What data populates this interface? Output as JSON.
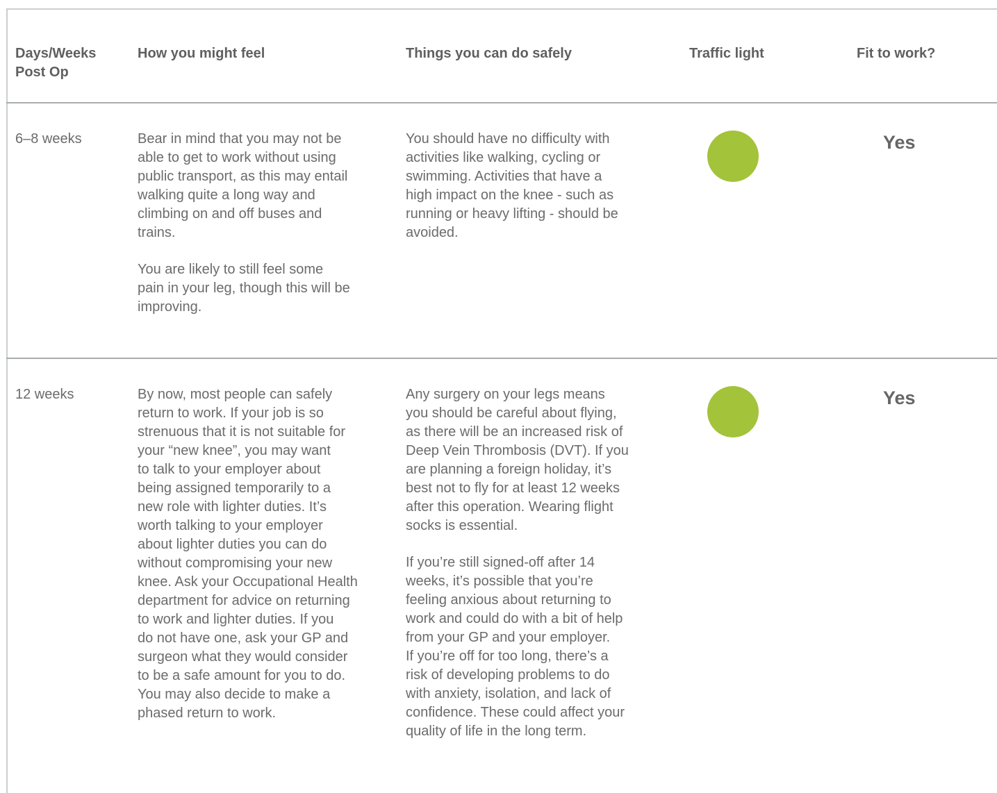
{
  "table": {
    "headers": {
      "period": "Days/Weeks\nPost Op",
      "feel": "How you might feel",
      "safe": "Things you can do safely",
      "light": "Traffic light",
      "fit": "Fit to work?"
    },
    "rows": [
      {
        "period": "6–8 weeks",
        "feel": [
          "Bear in mind that you may not be\nable to get to work without using\npublic transport, as this may entail\nwalking quite a long way and\nclimbing on and off buses and\ntrains.",
          "You are likely to still feel some\npain in your leg, though this will be\nimproving."
        ],
        "safe": [
          "You should have no difficulty with\nactivities like walking, cycling or\nswimming. Activities that have a\nhigh impact on the knee - such as\nrunning or heavy lifting - should be\navoided."
        ],
        "light_color": "#a3c33b",
        "fit": "Yes"
      },
      {
        "period": "12 weeks",
        "feel": [
          "By now, most people can safely\nreturn to work. If your job is so\nstrenuous that it is not suitable for\nyour “new knee”, you may want\nto talk to your employer about\nbeing assigned temporarily to a\nnew role with lighter duties. It’s\nworth talking to your employer\nabout lighter duties you can do\nwithout compromising your new\nknee. Ask your Occupational Health\ndepartment for advice on returning\nto work and lighter duties. If you\ndo not have one, ask your GP and\nsurgeon what they would consider\nto be a safe amount for you to do.\nYou may also decide to make a\nphased return to work."
        ],
        "safe": [
          "Any surgery on your legs means\nyou should be careful about flying,\nas there will be an increased risk of\nDeep Vein Thrombosis (DVT). If you\nare planning a foreign holiday, it’s\nbest not to fly for at least 12 weeks\nafter this operation. Wearing flight\nsocks is essential.",
          "If you’re still signed-off after 14\nweeks, it’s possible that you’re\nfeeling anxious about returning to\nwork and could do with a bit of help\nfrom your GP and your employer.\nIf you’re off for too long, there’s a\nrisk of developing problems to do\nwith anxiety, isolation, and lack of\nconfidence. These could affect your\nquality of life in the long term."
        ],
        "light_color": "#a3c33b",
        "fit": "Yes"
      }
    ]
  }
}
